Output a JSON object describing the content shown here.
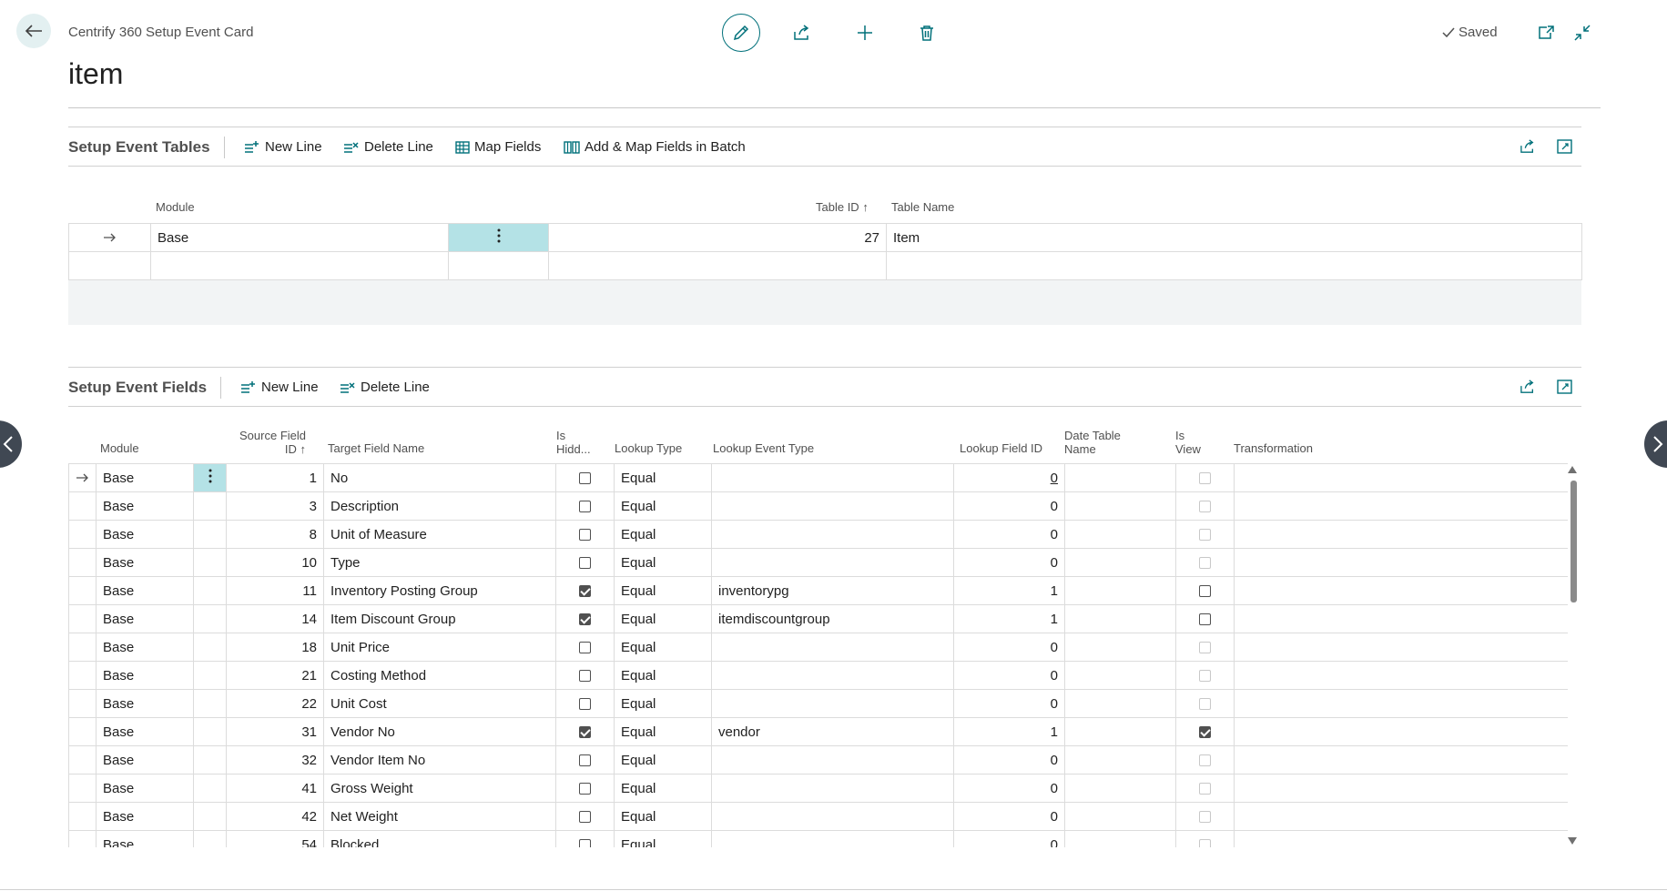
{
  "header": {
    "card_title": "Centrify 360 Setup Event Card",
    "page_title": "item",
    "saved_label": "Saved"
  },
  "tables_section": {
    "title": "Setup Event Tables",
    "actions": [
      "New Line",
      "Delete Line",
      "Map Fields",
      "Add & Map Fields in Batch"
    ],
    "columns": {
      "module": "Module",
      "table_id": "Table ID",
      "table_name": "Table Name"
    },
    "rows": [
      {
        "module": "Base",
        "table_id": "27",
        "table_name": "Item"
      }
    ]
  },
  "fields_section": {
    "title": "Setup Event Fields",
    "actions": [
      "New Line",
      "Delete Line"
    ],
    "columns": {
      "module": "Module",
      "source_field_id_1": "Source Field",
      "source_field_id_2": "ID",
      "target_field_name": "Target Field Name",
      "is_hidden_1": "Is",
      "is_hidden_2": "Hidd...",
      "lookup_type": "Lookup Type",
      "lookup_event_type": "Lookup Event Type",
      "lookup_field_id": "Lookup Field ID",
      "date_table_name_1": "Date Table",
      "date_table_name_2": "Name",
      "is_view_1": "Is",
      "is_view_2": "View",
      "transformation": "Transformation"
    },
    "rows": [
      {
        "module": "Base",
        "source_id": "1",
        "target": "No",
        "hidden": false,
        "lookup_type": "Equal",
        "event_type": "",
        "lookup_field_id": "0",
        "view": false,
        "view_enabled": false
      },
      {
        "module": "Base",
        "source_id": "3",
        "target": "Description",
        "hidden": false,
        "lookup_type": "Equal",
        "event_type": "",
        "lookup_field_id": "0",
        "view": false,
        "view_enabled": false
      },
      {
        "module": "Base",
        "source_id": "8",
        "target": "Unit of Measure",
        "hidden": false,
        "lookup_type": "Equal",
        "event_type": "",
        "lookup_field_id": "0",
        "view": false,
        "view_enabled": false
      },
      {
        "module": "Base",
        "source_id": "10",
        "target": "Type",
        "hidden": false,
        "lookup_type": "Equal",
        "event_type": "",
        "lookup_field_id": "0",
        "view": false,
        "view_enabled": false
      },
      {
        "module": "Base",
        "source_id": "11",
        "target": "Inventory Posting Group",
        "hidden": true,
        "lookup_type": "Equal",
        "event_type": "inventorypg",
        "lookup_field_id": "1",
        "view": false,
        "view_enabled": true
      },
      {
        "module": "Base",
        "source_id": "14",
        "target": "Item Discount Group",
        "hidden": true,
        "lookup_type": "Equal",
        "event_type": "itemdiscountgroup",
        "lookup_field_id": "1",
        "view": false,
        "view_enabled": true
      },
      {
        "module": "Base",
        "source_id": "18",
        "target": "Unit Price",
        "hidden": false,
        "lookup_type": "Equal",
        "event_type": "",
        "lookup_field_id": "0",
        "view": false,
        "view_enabled": false
      },
      {
        "module": "Base",
        "source_id": "21",
        "target": "Costing Method",
        "hidden": false,
        "lookup_type": "Equal",
        "event_type": "",
        "lookup_field_id": "0",
        "view": false,
        "view_enabled": false
      },
      {
        "module": "Base",
        "source_id": "22",
        "target": "Unit Cost",
        "hidden": false,
        "lookup_type": "Equal",
        "event_type": "",
        "lookup_field_id": "0",
        "view": false,
        "view_enabled": false
      },
      {
        "module": "Base",
        "source_id": "31",
        "target": "Vendor No",
        "hidden": true,
        "lookup_type": "Equal",
        "event_type": "vendor",
        "lookup_field_id": "1",
        "view": true,
        "view_enabled": true
      },
      {
        "module": "Base",
        "source_id": "32",
        "target": "Vendor Item No",
        "hidden": false,
        "lookup_type": "Equal",
        "event_type": "",
        "lookup_field_id": "0",
        "view": false,
        "view_enabled": false
      },
      {
        "module": "Base",
        "source_id": "41",
        "target": "Gross Weight",
        "hidden": false,
        "lookup_type": "Equal",
        "event_type": "",
        "lookup_field_id": "0",
        "view": false,
        "view_enabled": false
      },
      {
        "module": "Base",
        "source_id": "42",
        "target": "Net Weight",
        "hidden": false,
        "lookup_type": "Equal",
        "event_type": "",
        "lookup_field_id": "0",
        "view": false,
        "view_enabled": false
      },
      {
        "module": "Base",
        "source_id": "54",
        "target": "Blocked",
        "hidden": false,
        "lookup_type": "Equal",
        "event_type": "",
        "lookup_field_id": "0",
        "view": false,
        "view_enabled": false
      }
    ]
  },
  "colors": {
    "accent": "#00707a",
    "selected_cell": "#b4e2e6",
    "back_button_bg": "#e3f0f1"
  }
}
